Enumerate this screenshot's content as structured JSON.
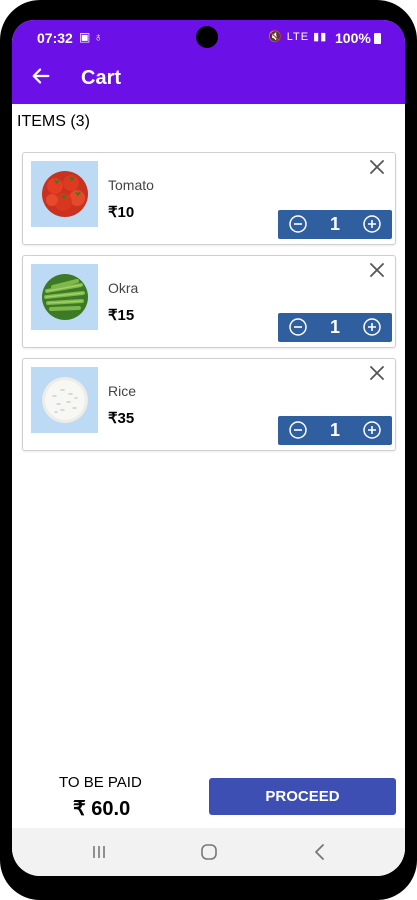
{
  "status_bar": {
    "time": "07:32",
    "left_icons": "▣ ♁",
    "right_icons": "🔇 LTE ▮▮",
    "battery": "100%"
  },
  "app_bar": {
    "title": "Cart",
    "back_icon": "arrow-left-icon"
  },
  "cart": {
    "items_label": "ITEMS (3)",
    "items": [
      {
        "name": "Tomato",
        "price": "₹10",
        "quantity": "1",
        "image": "tomato-image",
        "thumb_color": "#bcdaf3"
      },
      {
        "name": "Okra",
        "price": "₹15",
        "quantity": "1",
        "image": "okra-image",
        "thumb_color": "#bcdaf3"
      },
      {
        "name": "Rice",
        "price": "₹35",
        "quantity": "1",
        "image": "rice-image",
        "thumb_color": "#bcdaf3"
      }
    ]
  },
  "footer": {
    "pay_label": "TO BE PAID",
    "pay_total": "₹ 60.0",
    "proceed_label": "PROCEED"
  },
  "colors": {
    "primary": "#6b10e6",
    "stepper": "#2f5f9e",
    "proceed": "#3d4fb3"
  }
}
